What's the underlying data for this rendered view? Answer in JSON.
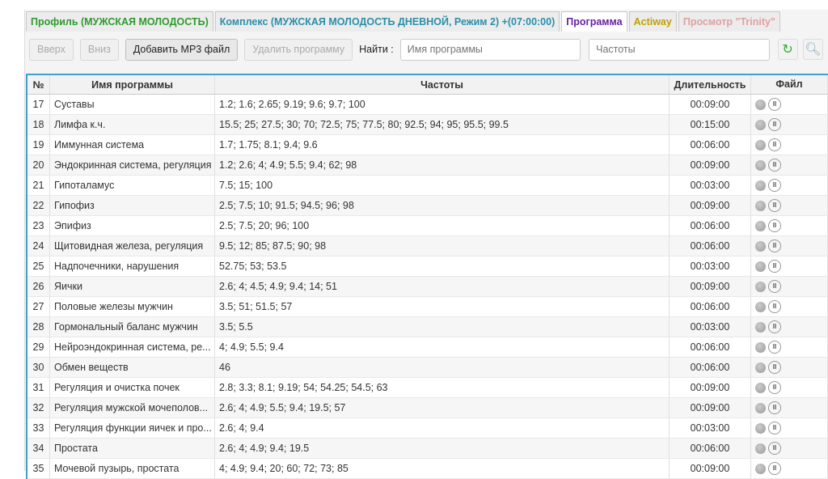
{
  "tabs": [
    {
      "label": "Профиль (МУЖСКАЯ МОЛОДОСТЬ)",
      "color": "#2e9a2e"
    },
    {
      "label": "Комплекс (МУЖСКАЯ МОЛОДОСТЬ ДНЕВНОЙ, Режим 2) +(07:00:00)",
      "color": "#2a8fa8"
    },
    {
      "label": "Программа",
      "color": "#6a1fa0"
    },
    {
      "label": "Actiway",
      "color": "#c0a000"
    },
    {
      "label": "Просмотр \"Trinity\"",
      "color": "#e0a0a0"
    }
  ],
  "toolbar": {
    "up": "Вверх",
    "down": "Вниз",
    "add_mp3": "Добавить MP3 файл",
    "delete": "Удалить программу",
    "find_label": "Найти  :",
    "name_placeholder": "Имя программы",
    "freq_placeholder": "Частоты"
  },
  "table": {
    "headers": [
      "№",
      "Имя программы",
      "Частоты",
      "Длительность",
      "Файл"
    ],
    "rows": [
      {
        "n": "17",
        "name": "Суставы",
        "freq": "1.2;  1.6;  2.65;  9.19;  9.6;  9.7;  100",
        "dur": "00:09:00"
      },
      {
        "n": "18",
        "name": "Лимфа к.ч.",
        "freq": "15.5;  25;  27.5;  30;  70;  72.5;  75;  77.5;  80;  92.5;  94;  95;  95.5;  99.5",
        "dur": "00:15:00"
      },
      {
        "n": "19",
        "name": "Иммунная система",
        "freq": "1.7;  1.75;  8.1;  9.4;  9.6",
        "dur": "00:06:00"
      },
      {
        "n": "20",
        "name": "Эндокринная система, регуляция",
        "freq": "1.2;  2.6;  4;  4.9;  5.5;  9.4;  62;  98",
        "dur": "00:09:00"
      },
      {
        "n": "21",
        "name": "Гипоталамус",
        "freq": "7.5;  15;  100",
        "dur": "00:03:00"
      },
      {
        "n": "22",
        "name": "Гипофиз",
        "freq": "2.5;  7.5;  10;  91.5;  94.5;  96;  98",
        "dur": "00:09:00"
      },
      {
        "n": "23",
        "name": "Эпифиз",
        "freq": "2.5;  7.5;  20;  96;  100",
        "dur": "00:06:00"
      },
      {
        "n": "24",
        "name": "Щитовидная железа, регуляция",
        "freq": "9.5;  12;  85;  87.5;  90;  98",
        "dur": "00:06:00"
      },
      {
        "n": "25",
        "name": "Надпочечники, нарушения",
        "freq": "52.75;  53;  53.5",
        "dur": "00:03:00"
      },
      {
        "n": "26",
        "name": "Яички",
        "freq": "2.6;  4;  4.5;  4.9;  9.4;  14;  51",
        "dur": "00:09:00"
      },
      {
        "n": "27",
        "name": "Половые железы мужчин",
        "freq": "3.5;  51;  51.5;  57",
        "dur": "00:06:00"
      },
      {
        "n": "28",
        "name": "Гормональный баланс мужчин",
        "freq": "3.5;  5.5",
        "dur": "00:03:00"
      },
      {
        "n": "29",
        "name": "Нейроэндокринная система, ре...",
        "freq": "4;  4.9;  5.5;  9.4",
        "dur": "00:06:00"
      },
      {
        "n": "30",
        "name": "Обмен веществ",
        "freq": "46",
        "dur": "00:06:00"
      },
      {
        "n": "31",
        "name": "Регуляция и очистка почек",
        "freq": "2.8;  3.3;  8.1;  9.19;  54;  54.25;  54.5;  63",
        "dur": "00:09:00"
      },
      {
        "n": "32",
        "name": "Регуляция мужской мочеполов...",
        "freq": "2.6;  4;  4.9;  5.5;  9.4;  19.5;  57",
        "dur": "00:09:00"
      },
      {
        "n": "33",
        "name": "Регуляция функции яичек и про...",
        "freq": "2.6;  4;  9.4",
        "dur": "00:03:00"
      },
      {
        "n": "34",
        "name": "Простата",
        "freq": "2.6;  4;  4.9;  9.4;  19.5",
        "dur": "00:06:00"
      },
      {
        "n": "35",
        "name": "Мочевой пузырь, простата",
        "freq": "4;  4.9;  9.4;  20;  60;  72;  73;  85",
        "dur": "00:09:00"
      }
    ]
  }
}
